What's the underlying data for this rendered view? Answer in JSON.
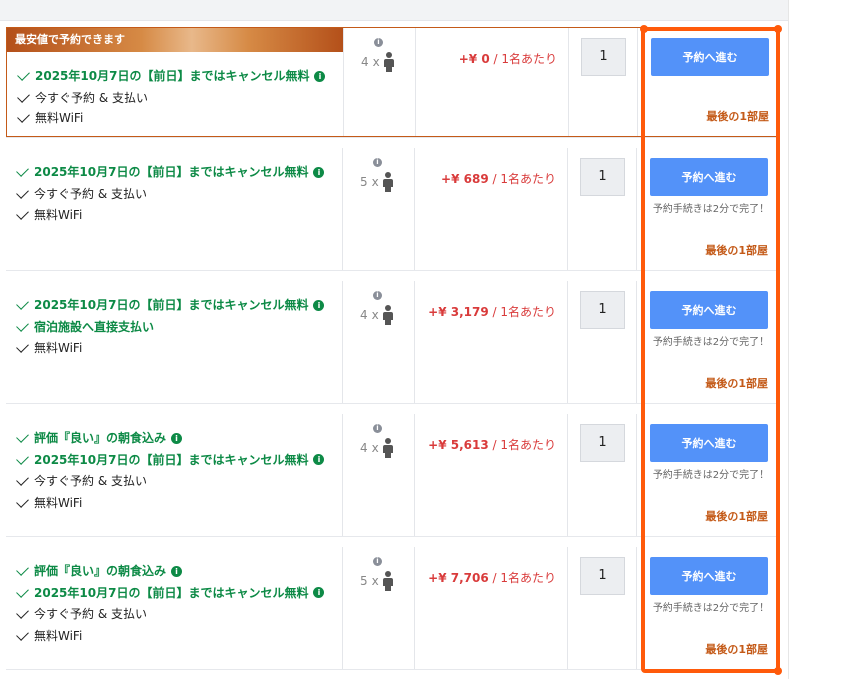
{
  "best_banner": "最安値で予約できます",
  "book_button_label": "予約へ進む",
  "last_room_label": "最後の1部屋",
  "booking_note": "予約手続きは2分で完了！",
  "per_person": " / 1名あたり",
  "occupancy_prefix_x": "x",
  "rooms": [
    {
      "features": [
        {
          "text": "2025年10月7日の【前日】まではキャンセル無料",
          "style": "green",
          "info": true
        },
        {
          "text": "今すぐ予約 & 支払い",
          "style": "plain",
          "info": false
        },
        {
          "text": "無料WiFi",
          "style": "plain",
          "info": false
        }
      ],
      "occupancy": "4",
      "price": "+¥ 0",
      "quantity": "1",
      "show_note": false
    },
    {
      "features": [
        {
          "text": "2025年10月7日の【前日】まではキャンセル無料",
          "style": "green",
          "info": true
        },
        {
          "text": "今すぐ予約 & 支払い",
          "style": "plain",
          "info": false
        },
        {
          "text": "無料WiFi",
          "style": "plain",
          "info": false
        }
      ],
      "occupancy": "5",
      "price": "+¥ 689",
      "quantity": "1",
      "show_note": true
    },
    {
      "features": [
        {
          "text": "2025年10月7日の【前日】まではキャンセル無料",
          "style": "green",
          "info": true
        },
        {
          "text": "宿泊施設へ直接支払い",
          "style": "green",
          "info": false
        },
        {
          "text": "無料WiFi",
          "style": "plain",
          "info": false
        }
      ],
      "occupancy": "4",
      "price": "+¥ 3,179",
      "quantity": "1",
      "show_note": true
    },
    {
      "features": [
        {
          "text": "評価『良い』の朝食込み",
          "style": "green",
          "info": true
        },
        {
          "text": "2025年10月7日の【前日】まではキャンセル無料",
          "style": "green",
          "info": true
        },
        {
          "text": "今すぐ予約 & 支払い",
          "style": "plain",
          "info": false
        },
        {
          "text": "無料WiFi",
          "style": "plain",
          "info": false
        }
      ],
      "occupancy": "4",
      "price": "+¥ 5,613",
      "quantity": "1",
      "show_note": true
    },
    {
      "features": [
        {
          "text": "評価『良い』の朝食込み",
          "style": "green",
          "info": true
        },
        {
          "text": "2025年10月7日の【前日】まではキャンセル無料",
          "style": "green",
          "info": true
        },
        {
          "text": "今すぐ予約 & 支払い",
          "style": "plain",
          "info": false
        },
        {
          "text": "無料WiFi",
          "style": "plain",
          "info": false
        }
      ],
      "occupancy": "5",
      "price": "+¥ 7,706",
      "quantity": "1",
      "show_note": true
    }
  ],
  "colors": {
    "accent_button": "#5392f9",
    "price_red": "#d93b3b",
    "feature_green": "#0d8a46",
    "last_room_orange": "#c45a18",
    "highlight": "#ff5a0a"
  },
  "icons": [
    "check-icon",
    "info-icon",
    "person-icon"
  ]
}
